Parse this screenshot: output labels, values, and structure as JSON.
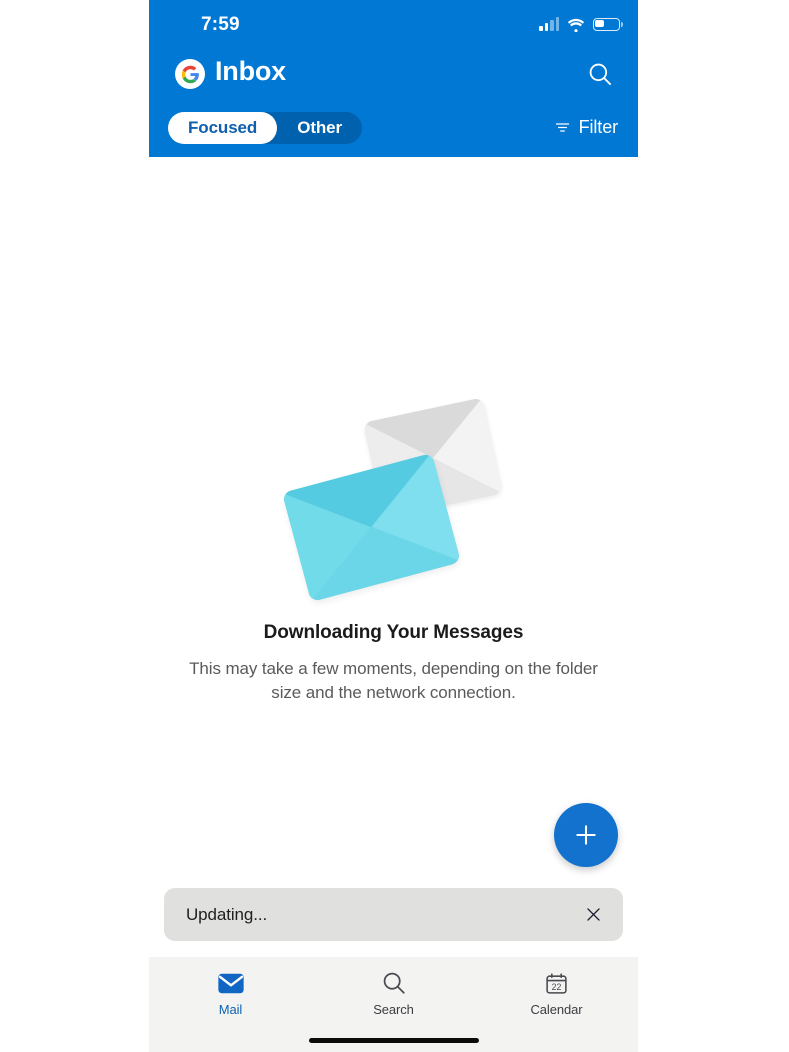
{
  "app": {
    "accent_blue": "#0078d4",
    "pivot_inactive_bg": "#0062ae",
    "fab_blue": "#1272ce",
    "envelope_cyan": "#6ad6e8",
    "envelope_gray": "#e6e6e6",
    "tabbar_bg": "#f3f3f2"
  },
  "status_bar": {
    "time": "7:59",
    "signal_icon": "cellular-signal-icon",
    "wifi_icon": "wifi-icon",
    "battery_icon": "battery-icon"
  },
  "header": {
    "account_icon": "google-g-icon",
    "title": "Inbox",
    "search_icon": "search-icon",
    "pivots": [
      {
        "label": "Focused",
        "active": true
      },
      {
        "label": "Other",
        "active": false
      }
    ],
    "filter": {
      "icon": "filter-icon",
      "label": "Filter"
    }
  },
  "empty_state": {
    "illustration": "two-envelopes-illustration",
    "title": "Downloading Your Messages",
    "subtitle": "This may take a few moments, depending on the folder size and the network connection."
  },
  "compose": {
    "icon": "plus-icon",
    "label": "+"
  },
  "toast": {
    "message": "Updating...",
    "close_icon": "close-icon"
  },
  "tabbar": {
    "items": [
      {
        "label": "Mail",
        "icon": "mail-icon",
        "active": true
      },
      {
        "label": "Search",
        "icon": "search-icon",
        "active": false
      },
      {
        "label": "Calendar",
        "icon": "calendar-icon",
        "active": false
      }
    ],
    "calendar_day": "22"
  }
}
